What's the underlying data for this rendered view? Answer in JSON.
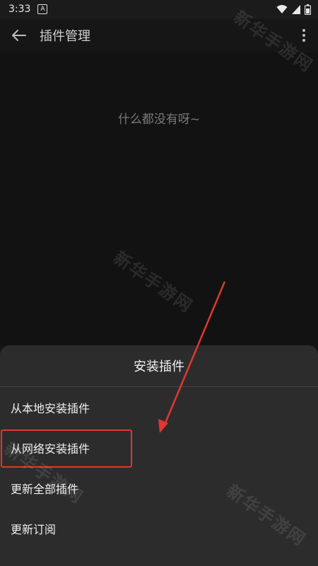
{
  "status_bar": {
    "time": "3:33",
    "notification_badge": "A"
  },
  "app_bar": {
    "title": "插件管理"
  },
  "empty_state": {
    "message": "什么都没有呀~"
  },
  "bottom_sheet": {
    "title": "安装插件",
    "items": [
      {
        "label": "从本地安装插件"
      },
      {
        "label": "从网络安装插件"
      },
      {
        "label": "更新全部插件"
      },
      {
        "label": "更新订阅"
      }
    ]
  },
  "watermark": {
    "text": "新华手游网"
  },
  "colors": {
    "background": "#151515",
    "sheet": "#2c2c2c",
    "annotation_red": "#e0382e"
  },
  "icons": {
    "back": "arrow-left-icon",
    "more": "more-vert-icon",
    "wifi": "wifi-icon",
    "signal": "signal-icon",
    "battery": "battery-icon"
  }
}
